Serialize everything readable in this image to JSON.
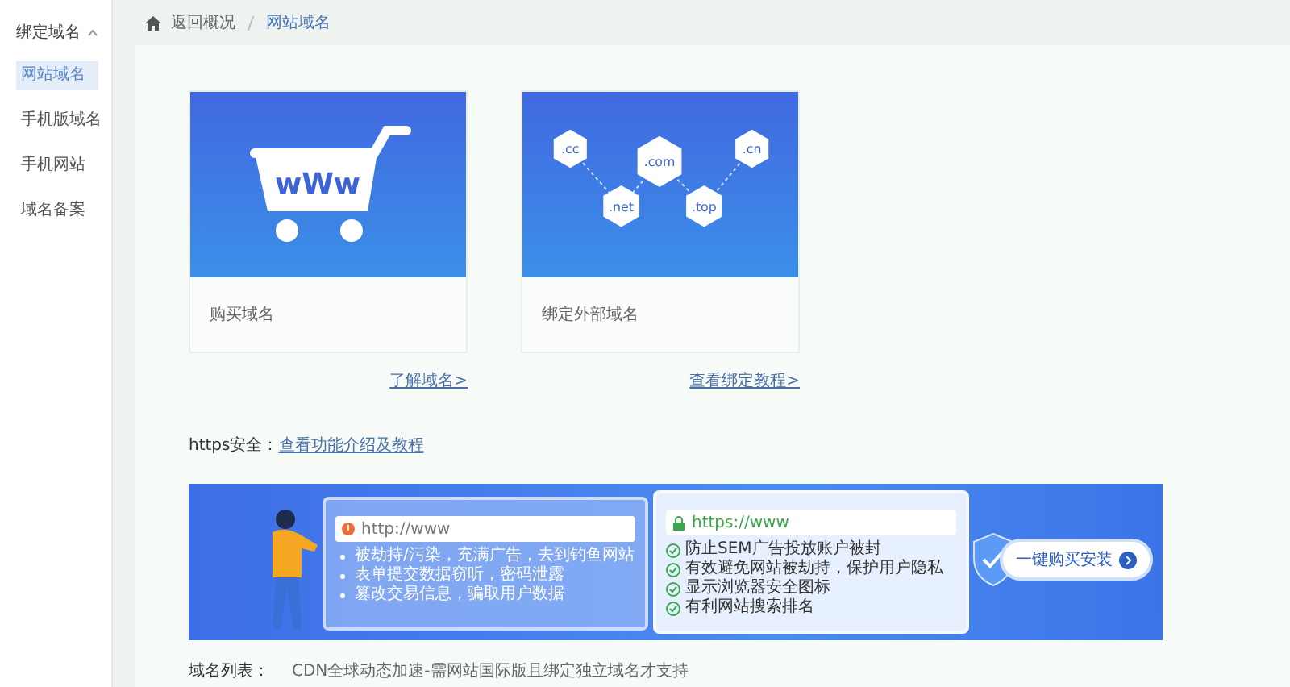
{
  "sidebar": {
    "title": "绑定域名",
    "items": [
      {
        "label": "网站域名",
        "selected": true
      },
      {
        "label": "手机版域名",
        "selected": false
      },
      {
        "label": "手机网站",
        "selected": false
      },
      {
        "label": "域名备案",
        "selected": false
      }
    ]
  },
  "breadcrumb": {
    "back": "返回概况",
    "current": "网站域名"
  },
  "cards": [
    {
      "kind": "cart",
      "label": "购买域名",
      "link": "了解域名>",
      "art_text": "wWw"
    },
    {
      "kind": "domains",
      "label": "绑定外部域名",
      "link": "查看绑定教程>",
      "tlds": [
        ".cc",
        ".com",
        ".cn",
        ".net",
        ".top"
      ]
    }
  ],
  "https": {
    "label": "https安全：",
    "link": "查看功能介绍及教程"
  },
  "banner": {
    "http_url": "http://www",
    "risks": [
      "被劫持/污染，充满广告，去到钓鱼网站",
      "表单提交数据窃听，密码泄露",
      "篡改交易信息，骗取用户数据"
    ],
    "https_url": "https://www",
    "benefits": [
      "防止SEM广告投放账户被封",
      "有效避免网站被劫持，保护用户隐私",
      "显示浏览器安全图标",
      "有利网站搜索排名"
    ],
    "button": "一键购买安装"
  },
  "footer": {
    "label": "域名列表：",
    "note": "CDN全球动态加速-需网站国际版且绑定独立域名才支持"
  }
}
